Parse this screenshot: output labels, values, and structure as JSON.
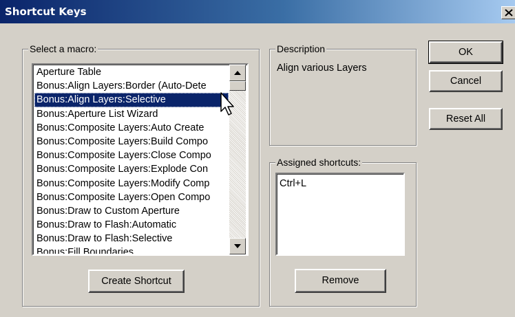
{
  "window": {
    "title": "Shortcut Keys",
    "close_icon": "close-icon"
  },
  "macro_group": {
    "legend": "Select a macro:",
    "items": [
      "Aperture Table",
      "Bonus:Align Layers:Border (Auto-Dete",
      "Bonus:Align Layers:Selective",
      "Bonus:Aperture List Wizard",
      "Bonus:Composite Layers:Auto Create",
      "Bonus:Composite Layers:Build Compo",
      "Bonus:Composite Layers:Close Compo",
      "Bonus:Composite Layers:Explode Con",
      "Bonus:Composite Layers:Modify Comp",
      "Bonus:Composite Layers:Open Compo",
      "Bonus:Draw to Custom Aperture",
      "Bonus:Draw to Flash:Automatic",
      "Bonus:Draw to Flash:Selective",
      "Bonus:Fill Boundaries"
    ],
    "selected_index": 2,
    "create_button": "Create Shortcut"
  },
  "description_group": {
    "legend": "Description",
    "text": "Align various Layers"
  },
  "shortcuts_group": {
    "legend": "Assigned shortcuts:",
    "items": [
      "Ctrl+L"
    ],
    "remove_button": "Remove"
  },
  "buttons": {
    "ok": "OK",
    "cancel": "Cancel",
    "reset_all": "Reset All"
  },
  "colors": {
    "title_bar": "#0a246a",
    "selection": "#0a246a",
    "dialog_face": "#d4d0c8"
  }
}
